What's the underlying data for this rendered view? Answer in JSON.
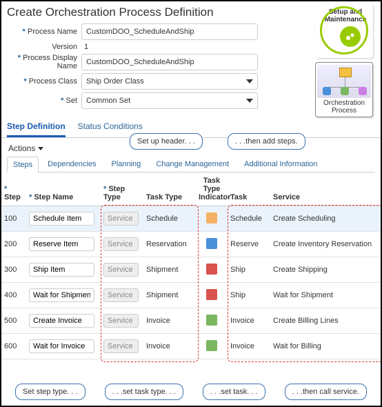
{
  "title": "Create Orchestration Process Definition",
  "badges": {
    "setup_label": "Setup and Maintenance",
    "orch_label": "Orchestration Process"
  },
  "form": {
    "process_name_label": "Process Name",
    "process_name_value": "CustomDOO_ScheduleAndShip",
    "version_label": "Version",
    "version_value": "1",
    "display_name_label": "Process Display Name",
    "display_name_value": "CustomDOO_ScheduleAndShip",
    "process_class_label": "Process Class",
    "process_class_value": "Ship Order Class",
    "set_label": "Set",
    "set_value": "Common Set"
  },
  "tabs": {
    "step_def": "Step Definition",
    "status_cond": "Status Conditions"
  },
  "callouts": {
    "header": "Set up header. . .",
    "add_steps": ". . .then add steps.",
    "step_type": "Set step type. . .",
    "task_type": ". . .set task type. . .",
    "task": ". . .set task. . .",
    "service": ". . .then call service."
  },
  "actions_label": "Actions",
  "subtabs": [
    "Steps",
    "Dependencies",
    "Planning",
    "Change Management",
    "Additional Information"
  ],
  "cols": {
    "step": "Step",
    "step_name": "Step Name",
    "step_type": "Step Type",
    "task_type": "Task Type",
    "task_type_ind": "Task Type Indicator",
    "task": "Task",
    "service": "Service"
  },
  "rows": [
    {
      "step": "100",
      "name": "Schedule Item",
      "step_type": "Service",
      "task_type": "Schedule",
      "icon": "schedule-icon",
      "icon_bg": "#f4b164",
      "task": "Schedule",
      "service": "Create Scheduling"
    },
    {
      "step": "200",
      "name": "Reserve Item",
      "step_type": "Service",
      "task_type": "Reservation",
      "icon": "reserve-icon",
      "icon_bg": "#4a90d9",
      "task": "Reserve",
      "service": "Create Inventory Reservation"
    },
    {
      "step": "300",
      "name": "Ship Item",
      "step_type": "Service",
      "task_type": "Shipment",
      "icon": "ship-icon",
      "icon_bg": "#d9534f",
      "task": "Ship",
      "service": "Create Shipping"
    },
    {
      "step": "400",
      "name": "Wait for Shipment",
      "step_type": "Service",
      "task_type": "Shipment",
      "icon": "ship-icon",
      "icon_bg": "#d9534f",
      "task": "Ship",
      "service": "Wait for Shipment"
    },
    {
      "step": "500",
      "name": "Create Invoice",
      "step_type": "Service",
      "task_type": "Invoice",
      "icon": "invoice-icon",
      "icon_bg": "#7bb661",
      "task": "Invoice",
      "service": "Create Billing Lines"
    },
    {
      "step": "600",
      "name": "Wait for Invoice",
      "step_type": "Service",
      "task_type": "Invoice",
      "icon": "invoice-icon",
      "icon_bg": "#7bb661",
      "task": "Invoice",
      "service": "Wait for Billing"
    }
  ]
}
